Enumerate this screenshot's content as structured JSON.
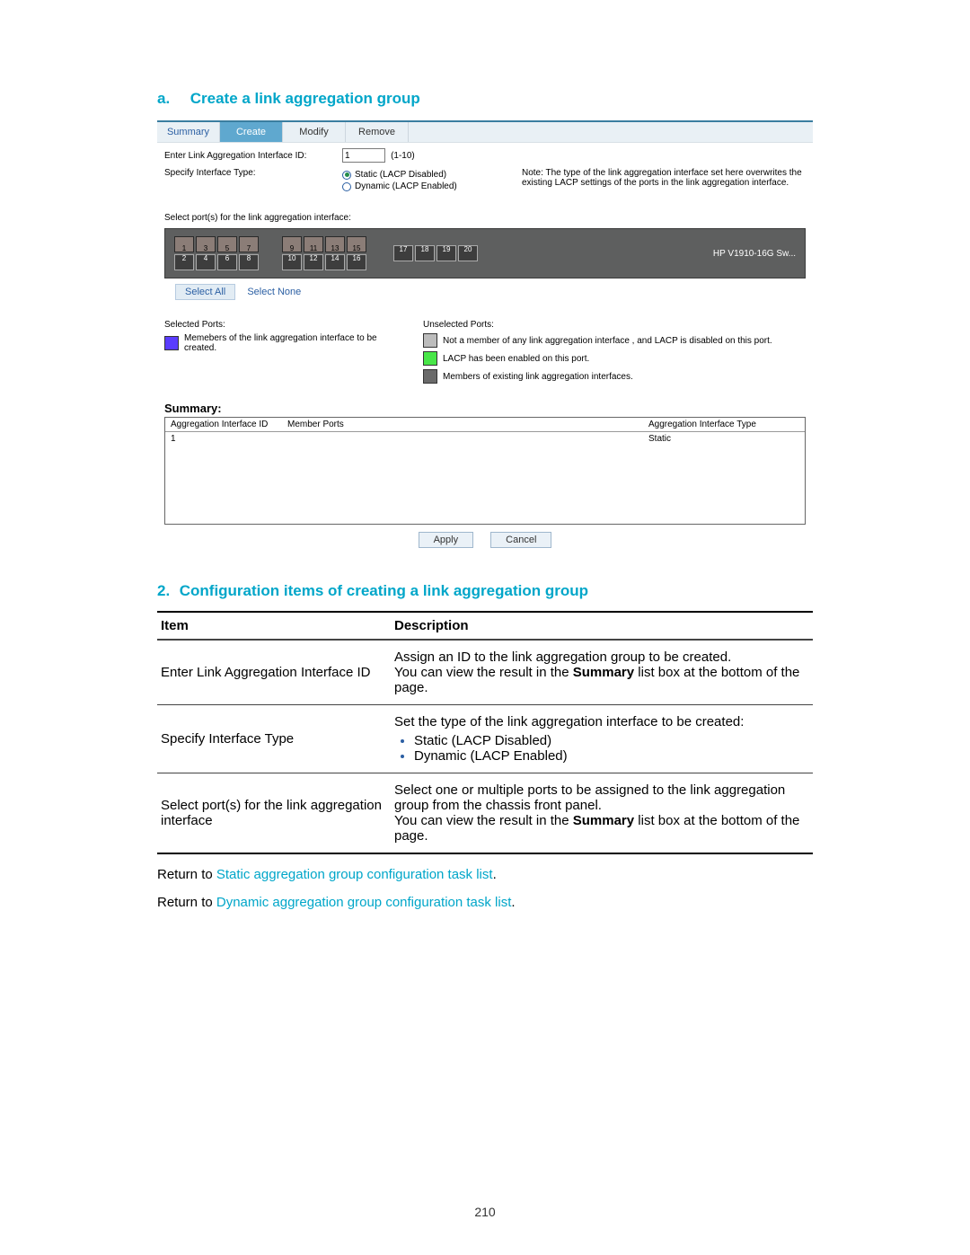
{
  "heading_a": {
    "prefix": "a.",
    "text": "Create a link aggregation group"
  },
  "tabs": {
    "summary": "Summary",
    "create": "Create",
    "modify": "Modify",
    "remove": "Remove"
  },
  "form": {
    "id_label": "Enter Link Aggregation Interface ID:",
    "id_value": "1",
    "id_range": "(1-10)",
    "type_label": "Specify Interface Type:",
    "type_static": "Static (LACP Disabled)",
    "type_dynamic": "Dynamic (LACP Enabled)",
    "note": "Note: The type of the link aggregation interface set here overwrites the existing LACP settings of the ports in the link aggregation interface.",
    "select_ports_label": "Select port(s) for the link aggregation interface:"
  },
  "ports": {
    "top": [
      "1",
      "3",
      "5",
      "7",
      "9",
      "11",
      "13",
      "15"
    ],
    "bottom": [
      "2",
      "4",
      "6",
      "8",
      "10",
      "12",
      "14",
      "16",
      "17",
      "18",
      "19",
      "20"
    ],
    "device": "HP V1910-16G Sw..."
  },
  "select_buttons": {
    "all": "Select All",
    "none": "Select None"
  },
  "legend": {
    "selected_hdr": "Selected Ports:",
    "selected_legend": "Memebers of the link aggregation interface to be created.",
    "unselected_hdr": "Unselected Ports:",
    "u1": "Not a member of any link aggregation interface , and LACP is disabled on this port.",
    "u2": "LACP has been enabled on this port.",
    "u3": "Members of existing link aggregation interfaces."
  },
  "summary": {
    "title": "Summary:",
    "cols": {
      "a": "Aggregation Interface ID",
      "b": "Member Ports",
      "c": "Aggregation Interface Type"
    },
    "row": {
      "id": "1",
      "members": "",
      "type": "Static"
    }
  },
  "buttons": {
    "apply": "Apply",
    "cancel": "Cancel"
  },
  "heading_2": {
    "prefix": "2.",
    "text": "Configuration items of creating a link aggregation group"
  },
  "table": {
    "head": {
      "item": "Item",
      "desc": "Description"
    },
    "rows": [
      {
        "item": "Enter Link Aggregation Interface ID",
        "d1a": "Assign an ID to the link aggregation group to be created.",
        "d1b_pre": "You can view the result in the ",
        "d1b_bold": "Summary",
        "d1b_post": " list box at the bottom of the page."
      },
      {
        "item": "Specify Interface Type",
        "d2a": "Set the type of the link aggregation interface to be created:",
        "d2_li1": "Static (LACP Disabled)",
        "d2_li2": "Dynamic (LACP Enabled)"
      },
      {
        "item": "Select port(s) for the link aggregation interface",
        "d3a": "Select one or multiple ports to be assigned to the link aggregation group from the chassis front panel.",
        "d3b_pre": "You can view the result in the ",
        "d3b_bold": "Summary",
        "d3b_post": " list box at the bottom of the page."
      }
    ]
  },
  "return": {
    "prefix": "Return to ",
    "link1": "Static aggregation group configuration task list",
    "link2": "Dynamic aggregation group configuration task list",
    "suffix": "."
  },
  "pagenum": "210"
}
